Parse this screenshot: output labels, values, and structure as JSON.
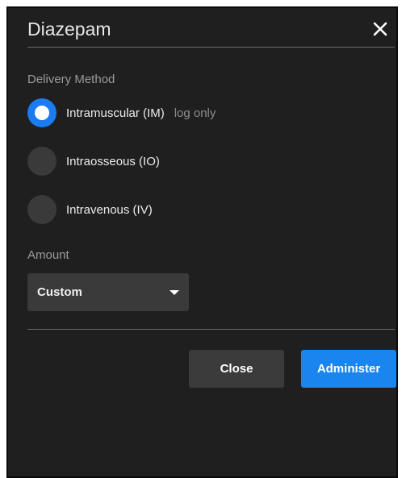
{
  "dialog": {
    "title": "Diazepam",
    "close_icon": "close-icon"
  },
  "delivery": {
    "label": "Delivery Method",
    "options": [
      {
        "label": "Intramuscular (IM)",
        "note": "log only",
        "selected": true
      },
      {
        "label": "Intraosseous (IO)",
        "note": "",
        "selected": false
      },
      {
        "label": "Intravenous (IV)",
        "note": "",
        "selected": false
      }
    ]
  },
  "amount": {
    "label": "Amount",
    "value": "Custom"
  },
  "actions": {
    "close_label": "Close",
    "administer_label": "Administer"
  },
  "colors": {
    "accent": "#1a85ee",
    "background": "#1f1f1f"
  }
}
